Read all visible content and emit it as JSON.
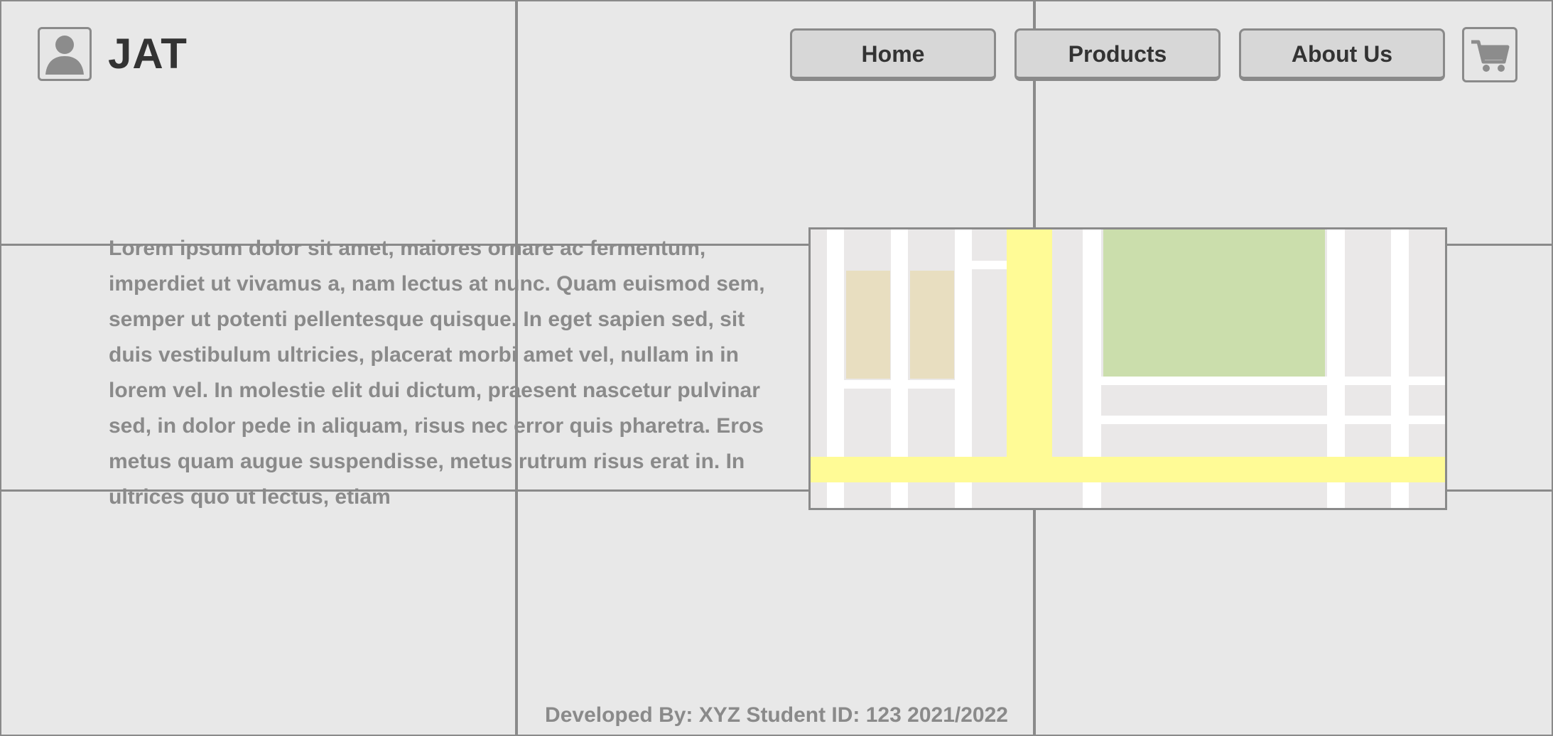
{
  "header": {
    "brand": "JAT",
    "avatar_icon": "user-avatar-icon",
    "cart_icon": "shopping-cart-icon"
  },
  "nav": {
    "home": "Home",
    "products": "Products",
    "about": "About Us"
  },
  "main": {
    "body_text": "Lorem ipsum dolor sit amet, maiores ornare ac fermentum, imperdiet ut vivamus a, nam lectus at nunc. Quam euismod sem, semper ut potenti pellentesque quisque. In eget sapien sed, sit duis vestibulum ultricies, placerat morbi amet vel, nullam in in lorem vel. In molestie elit dui dictum, praesent nascetur pulvinar sed, in dolor pede in aliquam, risus nec error quis pharetra. Eros metus quam augue suspendisse, metus rutrum risus erat in.  In ultrices quo ut lectus, etiam",
    "map_icon": "map-placeholder"
  },
  "footer": {
    "text": "Developed By: XYZ Student ID: 123 2021/2022"
  },
  "colors": {
    "background": "#e8e8e8",
    "border": "#8a8a8a",
    "button": "#d7d7d7",
    "map_road_major": "#fffb96",
    "map_park": "#cbdeac",
    "map_building": "#e8dec0"
  }
}
